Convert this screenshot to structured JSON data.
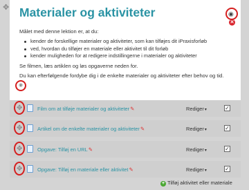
{
  "section": {
    "title": "Materialer og aktiviteter",
    "intro": "Målet med denne lektion er, at du:",
    "bullets": [
      "kender de forskellige materialer og aktiviteter, som kan tilføjes dit iPraxisforløb",
      "ved, hvordan du tilføjer en materiale eller aktivitet til dit forløb",
      "kender muligheden for at redigere indstillingerne i materialer og aktiviteter"
    ],
    "paragraph1": "Se filmen, læs artiklen og løs opgaverne neden for.",
    "paragraph2": "Du kan efterfølgende fordybe dig i de enkelte materialer og aktiviteter efter behov og tid."
  },
  "activities": [
    {
      "label": "Film om at tilføje materialer og aktiviteter",
      "edit_label": "Rediger"
    },
    {
      "label": "Artikel om de enkelte materialer og aktiviteter",
      "edit_label": "Rediger"
    },
    {
      "label": "Opgave: Tilføj en URL",
      "edit_label": "Rediger"
    },
    {
      "label": "Opgave: Tilføj en materiale eller aktivitet",
      "edit_label": "Rediger"
    }
  ],
  "footer": {
    "add_label": "Tilføj aktivitet eller materiale"
  },
  "icons": {
    "move": "move-arrows-icon",
    "visibility": "eye-icon",
    "delete": "close-icon",
    "file": "file-icon",
    "edit": "pencil-icon",
    "add": "plus-icon"
  },
  "colors": {
    "title": "#2a93a4",
    "link": "#2a93a4",
    "annotation": "#d51f1f",
    "add": "#4aa832"
  }
}
